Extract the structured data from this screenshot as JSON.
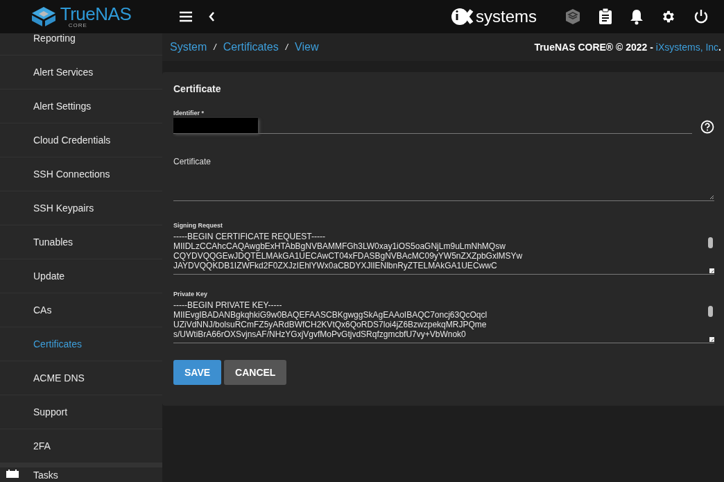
{
  "header": {
    "brand": "TrueNAS",
    "brand_sub": "CORE",
    "vendor": "systems"
  },
  "sidebar": {
    "items": [
      {
        "label": "Reporting",
        "selected": false
      },
      {
        "label": "Alert Services",
        "selected": false
      },
      {
        "label": "Alert Settings",
        "selected": false
      },
      {
        "label": "Cloud Credentials",
        "selected": false
      },
      {
        "label": "SSH Connections",
        "selected": false
      },
      {
        "label": "SSH Keypairs",
        "selected": false
      },
      {
        "label": "Tunables",
        "selected": false
      },
      {
        "label": "Update",
        "selected": false
      },
      {
        "label": "CAs",
        "selected": false
      },
      {
        "label": "Certificates",
        "selected": true
      },
      {
        "label": "ACME DNS",
        "selected": false
      },
      {
        "label": "Support",
        "selected": false
      },
      {
        "label": "2FA",
        "selected": false
      },
      {
        "label": "Tasks",
        "selected": false,
        "kind": "section"
      }
    ]
  },
  "breadcrumb": [
    {
      "label": "System"
    },
    {
      "separator": "/",
      "label": "Certificates"
    },
    {
      "separator": "/",
      "label": "View"
    }
  ],
  "copyright": {
    "text": "TrueNAS CORE® © 2022 - ",
    "link": "iXsystems, Inc",
    "tail": "."
  },
  "form": {
    "title": "Certificate",
    "fields": [
      {
        "kind": "input",
        "label": "Identifier *",
        "redacted": true
      },
      {
        "kind": "textarea",
        "label": "Certificate"
      },
      {
        "kind": "code",
        "label": "Signing Request",
        "lines": [
          "-----BEGIN CERTIFICATE REQUEST-----",
          "MIIDLzCCAhcCAQAwgbExHTAbBgNVBAMMFGh3LW0xay1iOS5oaGNjLm9uLmNhMQsw",
          "CQYDVQQGEwJDQTELMAkGA1UECAwCT04xFDASBgNVBAcMC09yYW5nZXZpbGxlMSYw",
          "JAYDVQQKDB1IZWFkd2F0ZXJzIEhlYWx0aCBDYXJlIENlbnRyZTELMAkGA1UECwwC"
        ]
      },
      {
        "kind": "code",
        "label": "Private Key",
        "lines": [
          "-----BEGIN PRIVATE KEY-----",
          "MIIEvgIBADANBgkqhkiG9w0BAQEFAASCBKgwggSkAgEAAoIBAQC7oncj63QcOqcl",
          "UZiVdNNJ/bolsuRCmFZ5yARdBWfCH2KVtQx6QoRDS7loi4jZ6BzwzpekqMRJPQme",
          "s/UWtiBrA66rOXSvjnsAF/NHzYGxjVgvfMoPvGtjvdSRqfzgmcbfU7vy+VbWnok0"
        ]
      }
    ],
    "buttons": [
      {
        "label": "SAVE",
        "kind": "primary"
      },
      {
        "label": "CANCEL",
        "kind": "secondary"
      }
    ]
  }
}
